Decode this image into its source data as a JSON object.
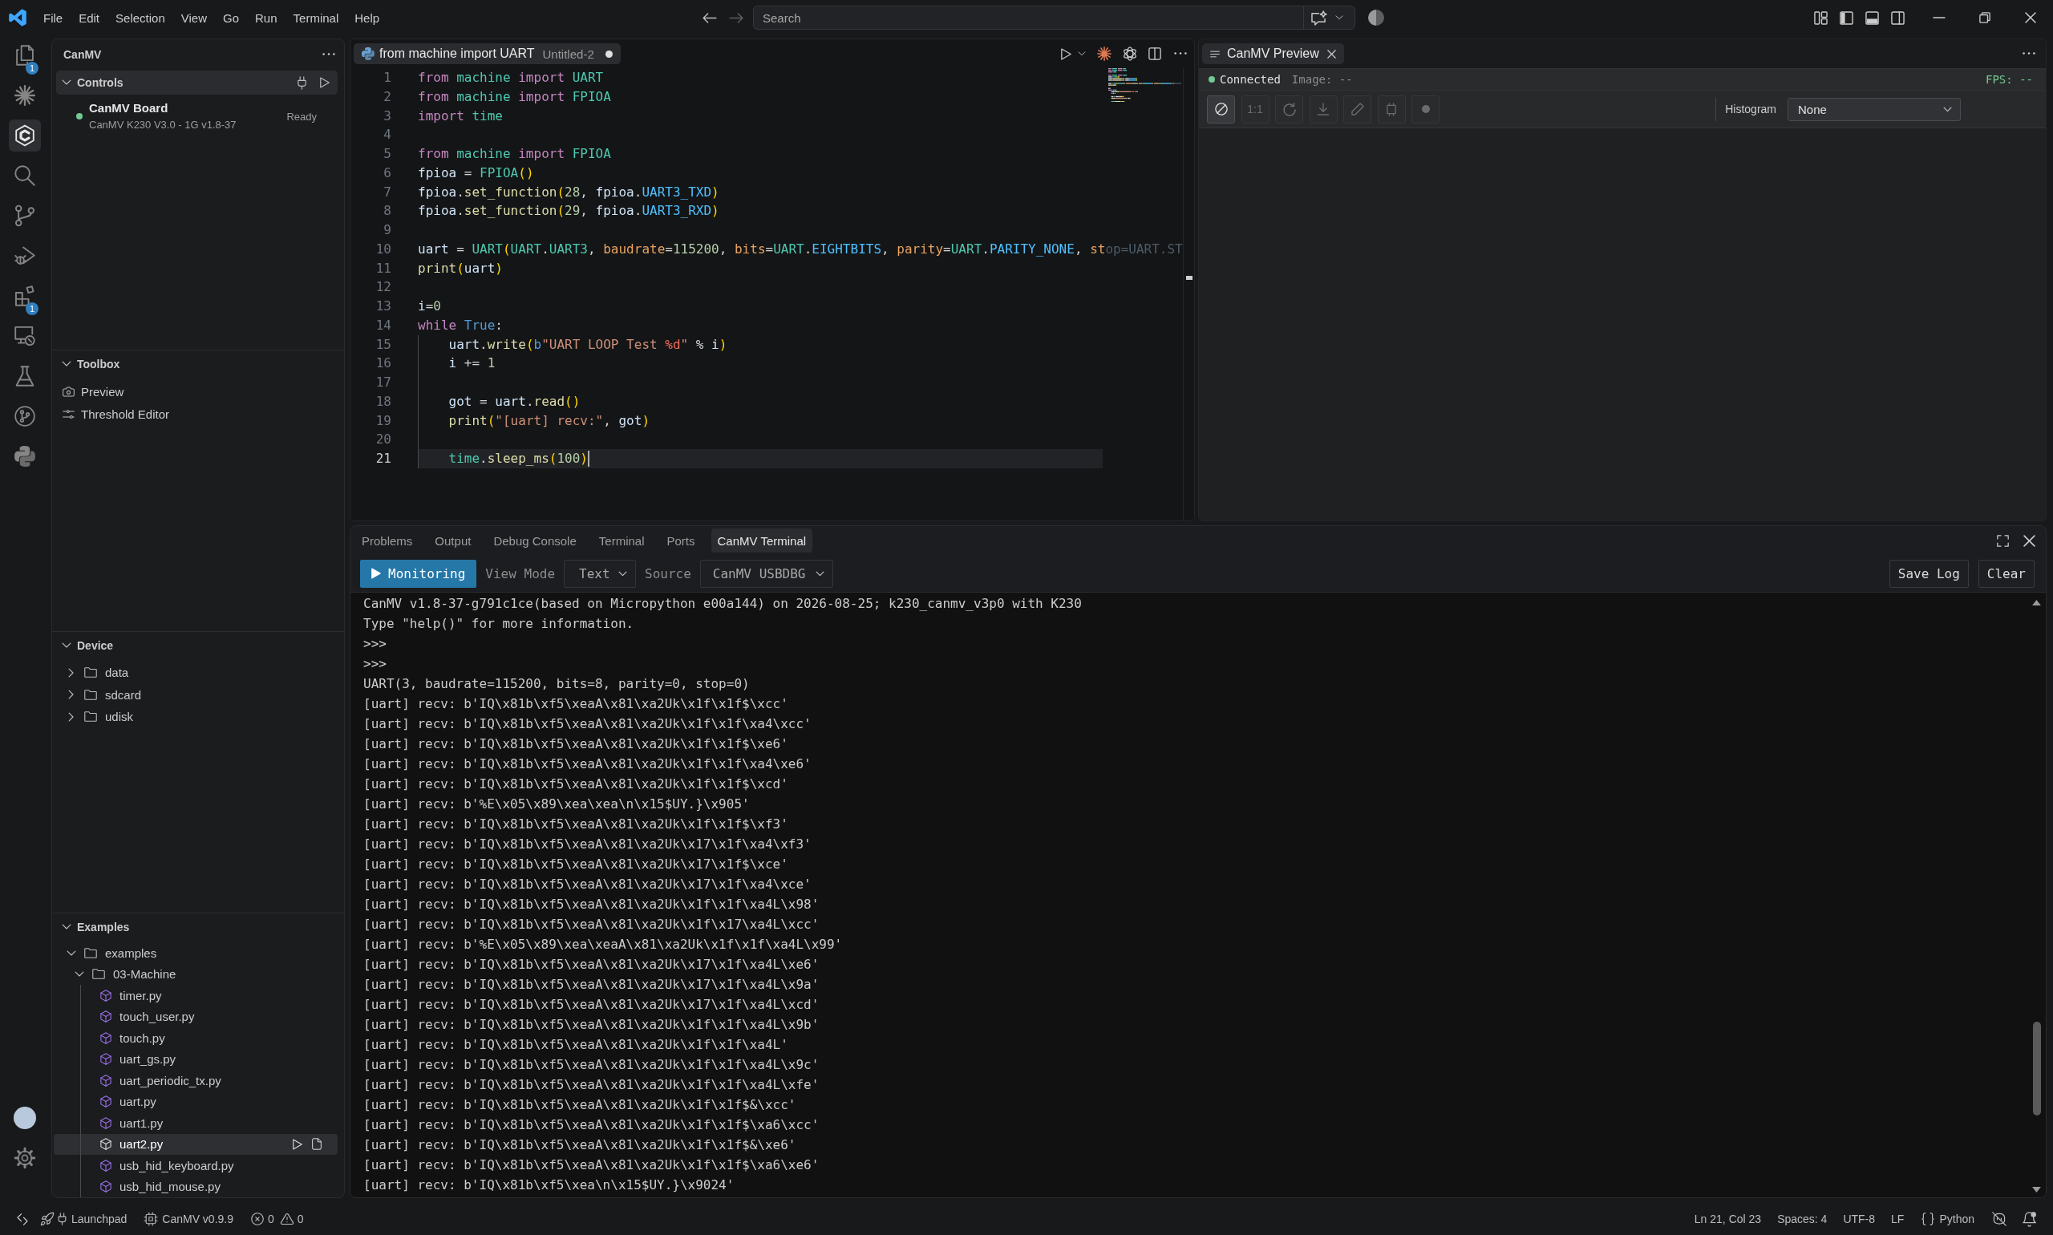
{
  "title_bar": {
    "menus": [
      "File",
      "Edit",
      "Selection",
      "View",
      "Go",
      "Run",
      "Terminal",
      "Help"
    ],
    "navigation": [
      {
        "disabled": false
      },
      {
        "disabled": true
      }
    ],
    "search": {
      "placeholder": "Search"
    }
  },
  "activity_bar": {
    "items": [
      {
        "badge": "1",
        "selected": false
      },
      {
        "selected": false
      },
      {
        "selected": true
      },
      {
        "selected": false
      },
      {
        "selected": false
      },
      {
        "selected": false
      },
      {
        "badge": "1",
        "selected": false
      },
      {
        "selected": false
      },
      {
        "selected": false
      },
      {
        "selected": false
      },
      {
        "selected": false
      }
    ]
  },
  "sidebar": {
    "title": "CanMV",
    "sections": [
      {
        "kind": "controls",
        "title": "Controls",
        "expanded": true,
        "selected": true,
        "board": {
          "name": "CanMV Board",
          "detail": "CanMV K230 V3.0 - 1G v1.8-37",
          "status": "Ready",
          "connected": true
        }
      },
      {
        "kind": "toolbox",
        "title": "Toolbox",
        "expanded": true,
        "selected": false,
        "items": [
          {
            "label": "Preview"
          },
          {
            "label": "Threshold Editor"
          }
        ]
      },
      {
        "kind": "device",
        "title": "Device",
        "expanded": true,
        "selected": false,
        "items": [
          {
            "name": "data",
            "expanded": false
          },
          {
            "name": "sdcard",
            "expanded": false
          },
          {
            "name": "udisk",
            "expanded": false
          }
        ]
      },
      {
        "kind": "examples",
        "title": "Examples",
        "expanded": true,
        "selected": false,
        "tree": [
          {
            "name": "examples",
            "expanded": true,
            "children": [
              {
                "name": "03-Machine",
                "expanded": true,
                "children": [
                  {
                    "name": "timer.py",
                    "selected": false
                  },
                  {
                    "name": "touch_user.py",
                    "selected": false
                  },
                  {
                    "name": "touch.py",
                    "selected": false
                  },
                  {
                    "name": "uart_gs.py",
                    "selected": false
                  },
                  {
                    "name": "uart_periodic_tx.py",
                    "selected": false
                  },
                  {
                    "name": "uart.py",
                    "selected": false
                  },
                  {
                    "name": "uart1.py",
                    "selected": false
                  },
                  {
                    "name": "uart2.py",
                    "selected": true
                  },
                  {
                    "name": "usb_hid_keyboard.py",
                    "selected": false
                  },
                  {
                    "name": "usb_hid_mouse.py",
                    "selected": false
                  }
                ]
              }
            ]
          }
        ]
      }
    ]
  },
  "editor": {
    "tab": {
      "title": "from machine import UART",
      "description": "Untitled-2",
      "modified": true
    },
    "lines": [
      {
        "number": "1",
        "current": false,
        "tokens": [
          {
            "text": "from",
            "kind": "kw"
          },
          {
            "text": " machine",
            "kind": "mod"
          },
          {
            "text": " import",
            "kind": "kw"
          },
          {
            "text": " UART",
            "kind": "mod"
          }
        ]
      },
      {
        "number": "2",
        "current": false,
        "tokens": [
          {
            "text": "from",
            "kind": "kw"
          },
          {
            "text": " machine",
            "kind": "mod"
          },
          {
            "text": " import",
            "kind": "kw"
          },
          {
            "text": " FPIOA",
            "kind": "mod"
          }
        ]
      },
      {
        "number": "3",
        "current": false,
        "tokens": [
          {
            "text": "import",
            "kind": "kw"
          },
          {
            "text": " time",
            "kind": "mod"
          }
        ]
      },
      {
        "number": "4",
        "current": false
      },
      {
        "number": "5",
        "current": false,
        "tokens": [
          {
            "text": "from",
            "kind": "kw"
          },
          {
            "text": " machine",
            "kind": "mod"
          },
          {
            "text": " import",
            "kind": "kw"
          },
          {
            "text": " FPIOA",
            "kind": "mod"
          }
        ]
      },
      {
        "number": "6",
        "current": false,
        "tokens": [
          {
            "text": "fpioa",
            "kind": "var"
          },
          {
            "text": " = ",
            "kind": "plain"
          },
          {
            "text": "FPIOA",
            "kind": "mod"
          },
          {
            "text": "()",
            "kind": "bracket"
          }
        ]
      },
      {
        "number": "7",
        "current": false,
        "tokens": [
          {
            "text": "fpioa",
            "kind": "var"
          },
          {
            "text": ".",
            "kind": "plain"
          },
          {
            "text": "set_function",
            "kind": "fn"
          },
          {
            "text": "(",
            "kind": "bracket"
          },
          {
            "text": "28",
            "kind": "num"
          },
          {
            "text": ", ",
            "kind": "plain"
          },
          {
            "text": "fpioa",
            "kind": "var"
          },
          {
            "text": ".",
            "kind": "plain"
          },
          {
            "text": "UART3_TXD",
            "kind": "const"
          },
          {
            "text": ")",
            "kind": "bracket"
          }
        ]
      },
      {
        "number": "8",
        "current": false,
        "tokens": [
          {
            "text": "fpioa",
            "kind": "var"
          },
          {
            "text": ".",
            "kind": "plain"
          },
          {
            "text": "set_function",
            "kind": "fn"
          },
          {
            "text": "(",
            "kind": "bracket"
          },
          {
            "text": "29",
            "kind": "num"
          },
          {
            "text": ", ",
            "kind": "plain"
          },
          {
            "text": "fpioa",
            "kind": "var"
          },
          {
            "text": ".",
            "kind": "plain"
          },
          {
            "text": "UART3_RXD",
            "kind": "const"
          },
          {
            "text": ")",
            "kind": "bracket"
          }
        ]
      },
      {
        "number": "9",
        "current": false
      },
      {
        "number": "10",
        "current": false,
        "tokens": [
          {
            "text": "uart",
            "kind": "var"
          },
          {
            "text": " = ",
            "kind": "plain"
          },
          {
            "text": "UART",
            "kind": "mod"
          },
          {
            "text": "(",
            "kind": "bracket"
          },
          {
            "text": "UART",
            "kind": "mod"
          },
          {
            "text": ".",
            "kind": "plain"
          },
          {
            "text": "UART3",
            "kind": "mod"
          },
          {
            "text": ", ",
            "kind": "plain"
          },
          {
            "text": "baudrate",
            "kind": "param"
          },
          {
            "text": "=",
            "kind": "plain"
          },
          {
            "text": "115200",
            "kind": "num"
          },
          {
            "text": ", ",
            "kind": "plain"
          },
          {
            "text": "bits",
            "kind": "param"
          },
          {
            "text": "=",
            "kind": "plain"
          },
          {
            "text": "UART",
            "kind": "mod"
          },
          {
            "text": ".",
            "kind": "plain"
          },
          {
            "text": "EIGHTBITS",
            "kind": "const"
          },
          {
            "text": ", ",
            "kind": "plain"
          },
          {
            "text": "parity",
            "kind": "param"
          },
          {
            "text": "=",
            "kind": "plain"
          },
          {
            "text": "UART",
            "kind": "mod"
          },
          {
            "text": ".",
            "kind": "plain"
          },
          {
            "text": "PARITY_NONE",
            "kind": "const"
          },
          {
            "text": ", ",
            "kind": "plain"
          },
          {
            "text": "st",
            "kind": "param"
          },
          {
            "text": "op=UART.ST",
            "kind": "faded"
          }
        ]
      },
      {
        "number": "11",
        "current": false,
        "tokens": [
          {
            "text": "print",
            "kind": "fn"
          },
          {
            "text": "(",
            "kind": "bracket"
          },
          {
            "text": "uart",
            "kind": "var"
          },
          {
            "text": ")",
            "kind": "bracket"
          }
        ]
      },
      {
        "number": "12",
        "current": false
      },
      {
        "number": "13",
        "current": false,
        "tokens": [
          {
            "text": "i",
            "kind": "var"
          },
          {
            "text": "=",
            "kind": "plain"
          },
          {
            "text": "0",
            "kind": "num"
          }
        ]
      },
      {
        "number": "14",
        "current": false,
        "tokens": [
          {
            "text": "while",
            "kind": "kw"
          },
          {
            "text": " True",
            "kind": "lit"
          },
          {
            "text": ":",
            "kind": "plain"
          }
        ]
      },
      {
        "number": "15",
        "current": false,
        "tokens": [
          {
            "text": "    uart",
            "kind": "var"
          },
          {
            "text": ".",
            "kind": "plain"
          },
          {
            "text": "write",
            "kind": "fn"
          },
          {
            "text": "(",
            "kind": "bracket"
          },
          {
            "text": "b",
            "kind": "lit"
          },
          {
            "text": "\"UART LOOP Test ",
            "kind": "str"
          },
          {
            "text": "%d",
            "kind": "fmt"
          },
          {
            "text": "\"",
            "kind": "str"
          },
          {
            "text": " % ",
            "kind": "plain"
          },
          {
            "text": "i",
            "kind": "var"
          },
          {
            "text": ")",
            "kind": "bracket"
          }
        ]
      },
      {
        "number": "16",
        "current": false,
        "tokens": [
          {
            "text": "    i",
            "kind": "var"
          },
          {
            "text": " += ",
            "kind": "plain"
          },
          {
            "text": "1",
            "kind": "num"
          }
        ]
      },
      {
        "number": "17",
        "current": false
      },
      {
        "number": "18",
        "current": false,
        "tokens": [
          {
            "text": "    got",
            "kind": "var"
          },
          {
            "text": " = ",
            "kind": "plain"
          },
          {
            "text": "uart",
            "kind": "var"
          },
          {
            "text": ".",
            "kind": "plain"
          },
          {
            "text": "read",
            "kind": "fn"
          },
          {
            "text": "()",
            "kind": "bracket"
          }
        ]
      },
      {
        "number": "19",
        "current": false,
        "tokens": [
          {
            "text": "    print",
            "kind": "fn"
          },
          {
            "text": "(",
            "kind": "bracket"
          },
          {
            "text": "\"[uart] recv:\"",
            "kind": "str"
          },
          {
            "text": ", ",
            "kind": "plain"
          },
          {
            "text": "got",
            "kind": "var"
          },
          {
            "text": ")",
            "kind": "bracket"
          }
        ]
      },
      {
        "number": "20",
        "current": false
      },
      {
        "number": "21",
        "current": true,
        "tokens": [
          {
            "text": "    time",
            "kind": "mod"
          },
          {
            "text": ".",
            "kind": "plain"
          },
          {
            "text": "sleep_ms",
            "kind": "fn"
          },
          {
            "text": "(",
            "kind": "bracket"
          },
          {
            "text": "100",
            "kind": "num"
          },
          {
            "text": ")",
            "kind": "bracket"
          }
        ]
      }
    ]
  },
  "preview": {
    "tab": {
      "title": "CanMV Preview"
    },
    "status": {
      "connected": true,
      "label": "Connected",
      "image": "Image: --",
      "fps": "FPS: --"
    },
    "tools": [
      {
        "kind": "icon",
        "disabled": false
      },
      {
        "kind": "text",
        "label": "1:1",
        "disabled": true
      },
      {
        "kind": "icon",
        "disabled": true
      },
      {
        "kind": "icon",
        "disabled": true
      },
      {
        "kind": "icon",
        "disabled": true
      },
      {
        "kind": "icon",
        "disabled": true
      },
      {
        "kind": "icon",
        "disabled": true
      }
    ],
    "histogram": {
      "label": "Histogram",
      "value": "None"
    }
  },
  "panel": {
    "tabs": [
      {
        "label": "Problems",
        "selected": false
      },
      {
        "label": "Output",
        "selected": false
      },
      {
        "label": "Debug Console",
        "selected": false
      },
      {
        "label": "Terminal",
        "selected": false
      },
      {
        "label": "Ports",
        "selected": false
      },
      {
        "label": "CanMV Terminal",
        "selected": true
      }
    ],
    "toolbar": {
      "monitor": "Monitoring",
      "view_mode_label": "View Mode",
      "view_mode": "Text",
      "source_label": "Source",
      "source": "CanMV USBDBG",
      "save": "Save Log",
      "clear": "Clear"
    },
    "output": [
      "CanMV v1.8-37-g791c1ce(based on Micropython e00a144) on 2026-08-25; k230_canmv_v3p0 with K230",
      "Type \"help()\" for more information.",
      ">>>",
      ">>>",
      "UART(3, baudrate=115200, bits=8, parity=0, stop=0)",
      "[uart] recv: b'IQ\\x81b\\xf5\\xeaA\\x81\\xa2Uk\\x1f\\x1f$\\xcc'",
      "[uart] recv: b'IQ\\x81b\\xf5\\xeaA\\x81\\xa2Uk\\x1f\\x1f\\xa4\\xcc'",
      "[uart] recv: b'IQ\\x81b\\xf5\\xeaA\\x81\\xa2Uk\\x1f\\x1f$\\xe6'",
      "[uart] recv: b'IQ\\x81b\\xf5\\xeaA\\x81\\xa2Uk\\x1f\\x1f\\xa4\\xe6'",
      "[uart] recv: b'IQ\\x81b\\xf5\\xeaA\\x81\\xa2Uk\\x1f\\x1f$\\xcd'",
      "[uart] recv: b'%E\\x05\\x89\\xea\\xea\\n\\x15$UY.}\\x905'",
      "[uart] recv: b'IQ\\x81b\\xf5\\xeaA\\x81\\xa2Uk\\x1f\\x1f$\\xf3'",
      "[uart] recv: b'IQ\\x81b\\xf5\\xeaA\\x81\\xa2Uk\\x17\\x1f\\xa4\\xf3'",
      "[uart] recv: b'IQ\\x81b\\xf5\\xeaA\\x81\\xa2Uk\\x17\\x1f$\\xce'",
      "[uart] recv: b'IQ\\x81b\\xf5\\xeaA\\x81\\xa2Uk\\x17\\x1f\\xa4\\xce'",
      "[uart] recv: b'IQ\\x81b\\xf5\\xeaA\\x81\\xa2Uk\\x1f\\x1f\\xa4L\\x98'",
      "[uart] recv: b'IQ\\x81b\\xf5\\xeaA\\x81\\xa2Uk\\x1f\\x17\\xa4L\\xcc'",
      "[uart] recv: b'%E\\x05\\x89\\xea\\xeaA\\x81\\xa2Uk\\x1f\\x1f\\xa4L\\x99'",
      "[uart] recv: b'IQ\\x81b\\xf5\\xeaA\\x81\\xa2Uk\\x17\\x1f\\xa4L\\xe6'",
      "[uart] recv: b'IQ\\x81b\\xf5\\xeaA\\x81\\xa2Uk\\x17\\x1f\\xa4L\\x9a'",
      "[uart] recv: b'IQ\\x81b\\xf5\\xeaA\\x81\\xa2Uk\\x17\\x1f\\xa4L\\xcd'",
      "[uart] recv: b'IQ\\x81b\\xf5\\xeaA\\x81\\xa2Uk\\x1f\\x1f\\xa4L\\x9b'",
      "[uart] recv: b'IQ\\x81b\\xf5\\xeaA\\x81\\xa2Uk\\x1f\\x1f\\xa4L'",
      "[uart] recv: b'IQ\\x81b\\xf5\\xeaA\\x81\\xa2Uk\\x1f\\x1f\\xa4L\\x9c'",
      "[uart] recv: b'IQ\\x81b\\xf5\\xeaA\\x81\\xa2Uk\\x1f\\x1f\\xa4L\\xfe'",
      "[uart] recv: b'IQ\\x81b\\xf5\\xeaA\\x81\\xa2Uk\\x1f\\x1f$&\\xcc'",
      "[uart] recv: b'IQ\\x81b\\xf5\\xeaA\\x81\\xa2Uk\\x1f\\x1f$\\xa6\\xcc'",
      "[uart] recv: b'IQ\\x81b\\xf5\\xeaA\\x81\\xa2Uk\\x1f\\x1f$&\\xe6'",
      "[uart] recv: b'IQ\\x81b\\xf5\\xeaA\\x81\\xa2Uk\\x1f\\x1f$\\xa6\\xe6'",
      "[uart] recv: b'IQ\\x81b\\xf5\\xea\\n\\x15$UY.}\\x9024'"
    ]
  },
  "status_bar": {
    "launchpad": "Launchpad",
    "extension": "CanMV v0.9.9",
    "errors": "0",
    "warnings": "0",
    "position": "Ln 21, Col 23",
    "indentation": "Spaces: 4",
    "encoding": "UTF-8",
    "line_ending": "LF",
    "language": "Python"
  }
}
